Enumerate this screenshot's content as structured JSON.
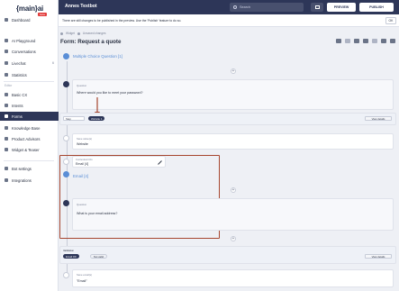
{
  "brand": {
    "logo_text": "{main}ai",
    "logo_badge": "beta"
  },
  "sidebar": {
    "items": [
      {
        "label": "Dashboard"
      },
      {
        "label": "AI Playground"
      },
      {
        "label": "Conversations"
      },
      {
        "label": "Livechat",
        "badge": "6"
      },
      {
        "label": "Statistics"
      }
    ],
    "section_label": "Editor",
    "editor_items": [
      {
        "label": "Basic CX"
      },
      {
        "label": "Intents"
      },
      {
        "label": "Forms",
        "active": true
      },
      {
        "label": "Knowledge Base"
      },
      {
        "label": "Product Advisors"
      },
      {
        "label": "Widget & Teaser"
      }
    ],
    "bottom_items": [
      {
        "label": "Bot settings"
      },
      {
        "label": "Integrations"
      }
    ]
  },
  "header": {
    "project_title": "Annes Textbot",
    "search_placeholder": "Search",
    "preview_label": "PREVIEW",
    "publish_label": "PUBLISH"
  },
  "notice": {
    "text": "There are still changes to be published in the preview. Use the 'Publish' feature to do so.",
    "ok_label": "OK"
  },
  "breadcrumb": {
    "section": "Widget",
    "status": "Unsaved changes"
  },
  "form": {
    "title": "Form: Request a quote"
  },
  "blocks": {
    "mcq_title": "Multiple Choice Question [1]",
    "q1_label": "Question",
    "q1_text": "Where would you like to meet your password?",
    "cond_select": "Step",
    "cond_chip": "Website",
    "cond_count": "1",
    "view_details": "View details",
    "save_label": "Save value(s)",
    "save_value": "Website",
    "cm_label": "Contextual info",
    "cm_value": "Email [4]",
    "email_title": "Email [4]",
    "q2_label": "Question",
    "q2_text": "What is your email address?",
    "validation_label": "Validation",
    "val_chip1": "Email OK",
    "val_chip2": "Not valid",
    "save2_label": "Save email(s)",
    "save2_value": "\"Email\""
  },
  "colors": {
    "brand_dark": "#2d3658",
    "accent_blue": "#5a8ed6",
    "highlight": "#a6462f"
  }
}
